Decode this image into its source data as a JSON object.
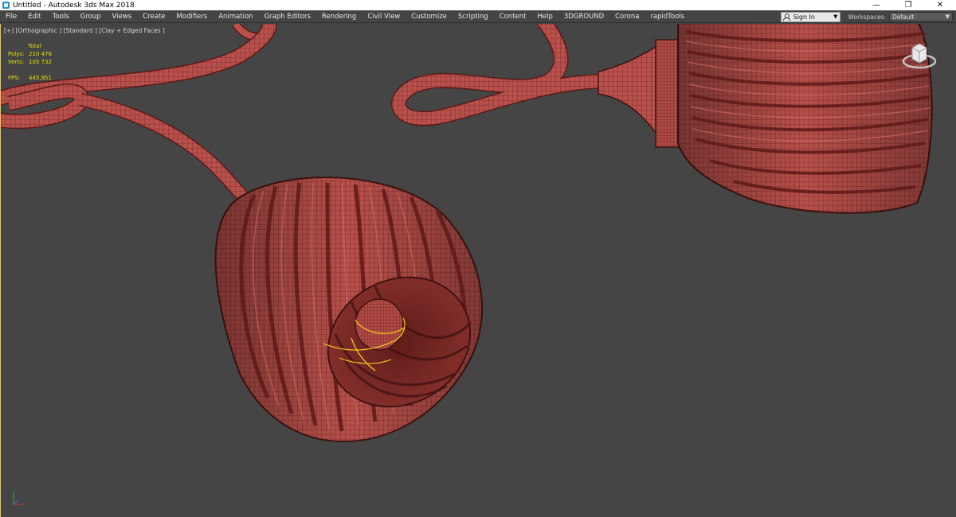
{
  "window": {
    "title": "Untitled - Autodesk 3ds Max 2018",
    "minimize_glyph": "—",
    "restore_glyph": "❐",
    "close_glyph": "✕"
  },
  "menu": {
    "items": [
      "File",
      "Edit",
      "Tools",
      "Group",
      "Views",
      "Create",
      "Modifiers",
      "Animation",
      "Graph Editors",
      "Rendering",
      "Civil View",
      "Customize",
      "Scripting",
      "Content",
      "Help",
      "3DGROUND",
      "Corona",
      "rapidTools"
    ],
    "signin_label": "Sign In",
    "workspaces_label": "Workspaces:",
    "workspace_value": "Default"
  },
  "viewport": {
    "label": "[+] [Orthographic ] [Standard ] [Clay + Edged Faces ]",
    "stats": {
      "header": "Total",
      "polys_label": "Polys:",
      "polys_value": "210 476",
      "verts_label": "Verts:",
      "verts_value": "105 732",
      "fps_label": "FPS:",
      "fps_value": "445,951"
    }
  },
  "icons": {
    "viewcube": "viewcube-icon",
    "axis": "axis-tripod-icon",
    "app": "3dsmax-app-icon"
  },
  "colors": {
    "model": "#b8504b",
    "model_dark": "#5a1a18",
    "viewport_bg": "#454545",
    "stats_text": "#e8e000",
    "selection_gizmo": "#ffd21a"
  }
}
